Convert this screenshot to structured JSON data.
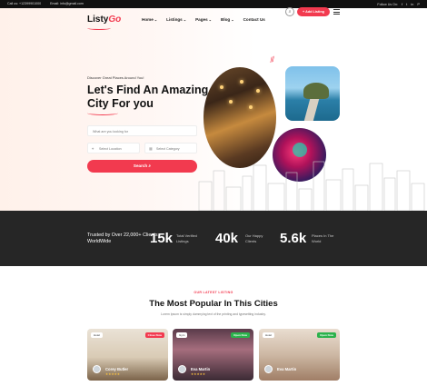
{
  "topbar": {
    "phone": "Call us: +12399901000",
    "email": "Email: info@gmail.com",
    "follow": "Follow Us On:",
    "socials": [
      "f",
      "t",
      "in",
      "P"
    ]
  },
  "brand": {
    "name_a": "Listy",
    "name_b": "Go"
  },
  "nav": {
    "items": [
      {
        "label": "Home",
        "caret": "⌄"
      },
      {
        "label": "Listings",
        "caret": "⌄"
      },
      {
        "label": "Pages",
        "caret": "⌄"
      },
      {
        "label": "Blog",
        "caret": "⌄"
      },
      {
        "label": "Contact Us",
        "caret": ""
      }
    ],
    "add_listing": "+ Add Listing"
  },
  "hero": {
    "eyebrow": "Discover Great Places Around You!",
    "headline": "Let's Find An Amazing City For you",
    "what_placeholder": "What are you looking for",
    "location_placeholder": "Select Location",
    "category_placeholder": "Select Category",
    "search_label": "Search"
  },
  "stats": {
    "trust": "Trusted by Over 22,000+ Clients WorldWide",
    "items": [
      {
        "num": "15k",
        "label": "Total Verified Listings"
      },
      {
        "num": "40k",
        "label": "Our Happy Clients"
      },
      {
        "num": "5.6k",
        "label": "Places In The World"
      }
    ]
  },
  "section": {
    "eyebrow": "OUR LATEST LISTING",
    "title": "The Most Popular In This Cities",
    "subtitle": "Lorem Ipsum is simply dummying text of the printing and typesetting industry."
  },
  "cards": [
    {
      "tag": "Hotel",
      "status": "Close Now",
      "status_color": "#f23a4f",
      "author": "Corey Butler",
      "rating": "★★★★★"
    },
    {
      "tag": "Gym",
      "status": "Open Now",
      "status_color": "#2bb24c",
      "author": "Eva Martin",
      "rating": "★★★★★"
    },
    {
      "tag": "Hotel",
      "status": "Open Now",
      "status_color": "#2bb24c",
      "author": "Eva Martin",
      "rating": ""
    }
  ],
  "colors": {
    "accent": "#f23a4f",
    "dark": "#262626"
  }
}
